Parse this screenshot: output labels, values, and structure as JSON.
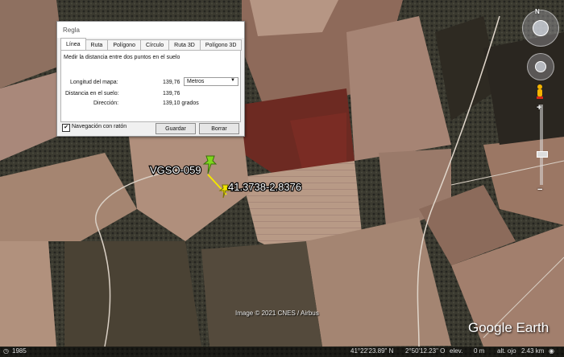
{
  "map": {
    "placemark_name": "VGSO-059",
    "cursor_coords": "41.3738-2.8376",
    "copyright": "Image © 2021 CNES / Airbus",
    "brand": "Google Earth"
  },
  "dialog": {
    "title": "Regla",
    "tabs": [
      "Línea",
      "Ruta",
      "Polígono",
      "Círculo",
      "Ruta 3D",
      "Polígono 3D"
    ],
    "active_tab": "Línea",
    "description": "Medir la distancia entre dos puntos en el suelo",
    "map_length_label": "Longitud del mapa:",
    "map_length_value": "139,76",
    "unit_selected": "Metros",
    "ground_distance_label": "Distancia en el suelo:",
    "ground_distance_value": "139,76",
    "direction_label": "Dirección:",
    "direction_value": "139,10 grados",
    "mouse_nav_label": "Navegación con ratón",
    "mouse_nav_checked": true,
    "save_label": "Guardar",
    "clear_label": "Borrar"
  },
  "nav": {
    "north_label": "N"
  },
  "status": {
    "year": "1985",
    "lat": "41°22'23.89\" N",
    "lon": "2°50'12.23\" O",
    "elev_label": "elev.",
    "elev_value": "0 m",
    "eye_label": "alt. ojo",
    "eye_value": "2.43 km"
  },
  "colors": {
    "ruler_line": "#f2e600",
    "placemark": "#7fd61e",
    "accent_blue": "#2f6bd8"
  }
}
